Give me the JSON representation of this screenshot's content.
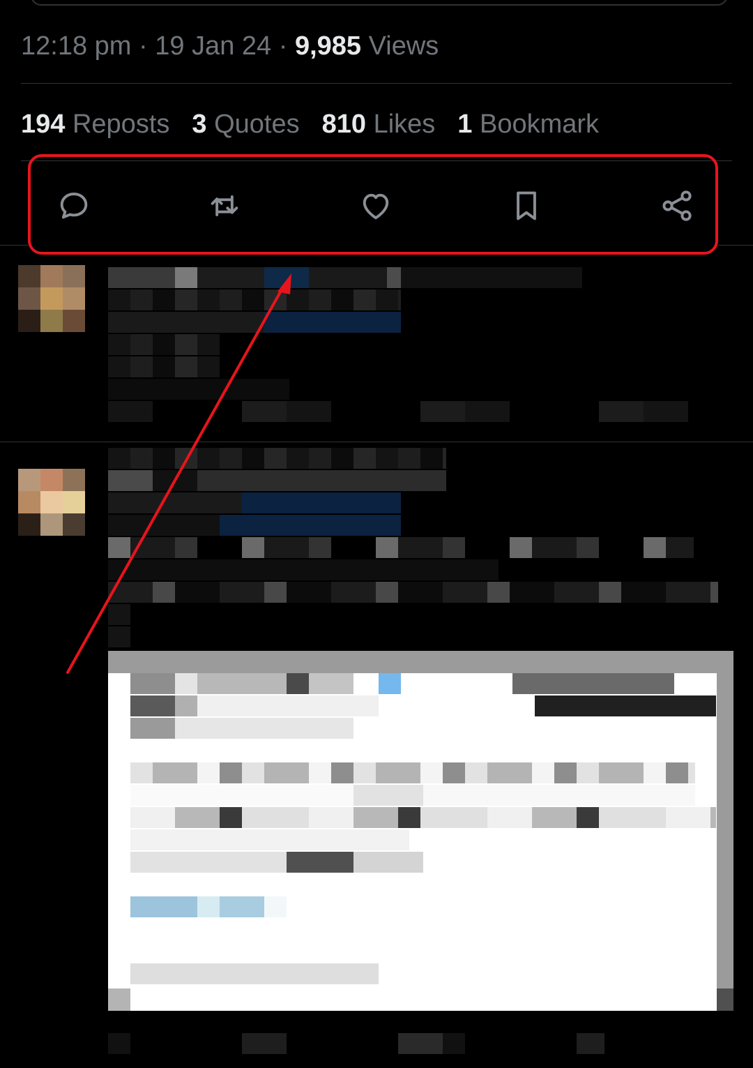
{
  "tweet_meta": {
    "time": "12:18 pm",
    "separator": "·",
    "date": "19 Jan 24",
    "views_count": "9,985",
    "views_label": "Views"
  },
  "engagement": {
    "reposts_count": "194",
    "reposts_label": "Reposts",
    "quotes_count": "3",
    "quotes_label": "Quotes",
    "likes_count": "810",
    "likes_label": "Likes",
    "bookmarks_count": "1",
    "bookmarks_label": "Bookmark"
  },
  "actions": [
    {
      "name": "reply",
      "icon": "reply-icon"
    },
    {
      "name": "repost",
      "icon": "repost-icon"
    },
    {
      "name": "like",
      "icon": "heart-icon"
    },
    {
      "name": "bookmark",
      "icon": "bookmark-icon"
    },
    {
      "name": "share",
      "icon": "share-icon"
    }
  ],
  "annotation": {
    "box_color": "#e8141c",
    "arrow_color": "#e8141c"
  },
  "colors": {
    "background": "#000000",
    "text_primary": "#e7e9ea",
    "text_secondary": "#71767b",
    "divider": "#2f3336"
  }
}
